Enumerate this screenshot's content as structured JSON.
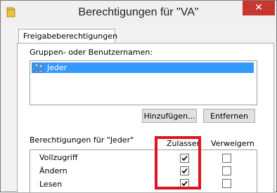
{
  "window": {
    "title": "Berechtigungen für \"VA\"",
    "close_glyph": "✕",
    "app_icon": "folder-icon"
  },
  "tabs": [
    {
      "label": "Freigabeberechtigungen"
    }
  ],
  "groups": {
    "label": "Gruppen- oder Benutzernamen:",
    "items": [
      {
        "label": "Jeder",
        "icon": "users-icon",
        "selected": true
      }
    ]
  },
  "buttons": {
    "add": "Hinzufügen...",
    "remove": "Entfernen"
  },
  "permissions": {
    "label": "Berechtigungen für \"Jeder\"",
    "col_allow": "Zulassen",
    "col_deny": "Verweigern",
    "rows": [
      {
        "name": "Vollzugriff",
        "allow": true,
        "deny": false
      },
      {
        "name": "Ändern",
        "allow": true,
        "deny": false
      },
      {
        "name": "Lesen",
        "allow": true,
        "deny": false
      }
    ]
  },
  "colors": {
    "selection": "#3399ff",
    "close": "#c7372f",
    "highlight": "#e0141e"
  }
}
